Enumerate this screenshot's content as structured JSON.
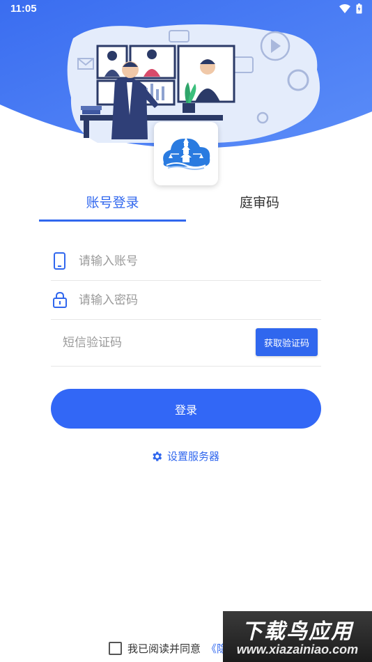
{
  "status_bar": {
    "time": "11:05"
  },
  "tabs": [
    {
      "label": "账号登录",
      "active": true
    },
    {
      "label": "庭审码",
      "active": false
    }
  ],
  "form": {
    "account": {
      "placeholder": "请输入账号",
      "value": ""
    },
    "password": {
      "placeholder": "请输入密码",
      "value": ""
    },
    "sms_code": {
      "placeholder": "短信验证码",
      "value": ""
    },
    "sms_button_label": "获取验证码"
  },
  "login_label": "登录",
  "server_settings_label": "设置服务器",
  "agreement": {
    "text": "我已阅读并同意",
    "link": "《隐"
  },
  "watermark": {
    "title": "下载鸟应用",
    "url": "www.xiazainiao.com"
  },
  "colors": {
    "primary": "#3067ee",
    "header_gradient_start": "#3a6df0",
    "header_gradient_end": "#5b8df8"
  }
}
